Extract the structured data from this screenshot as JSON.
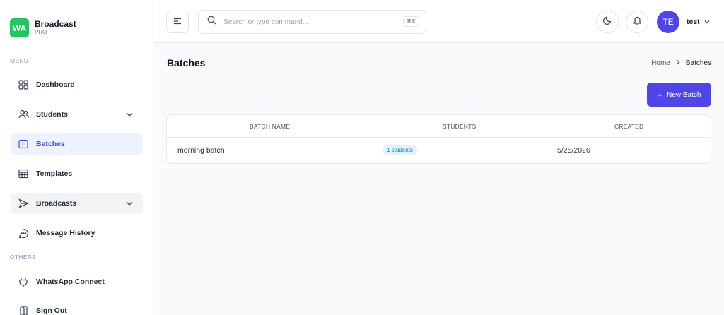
{
  "brand": {
    "logo_text": "WA",
    "name": "Broadcast",
    "sub": "PRO",
    "logo_color": "#22c55e"
  },
  "sidebar": {
    "menu_label": "MENU",
    "others_label": "OTHERS",
    "items": [
      {
        "label": "Dashboard",
        "icon": "grid-icon"
      },
      {
        "label": "Students",
        "icon": "users-icon",
        "expandable": true
      },
      {
        "label": "Batches",
        "icon": "list-box-icon",
        "active": true
      },
      {
        "label": "Templates",
        "icon": "table-icon"
      },
      {
        "label": "Broadcasts",
        "icon": "send-icon",
        "expandable": true
      },
      {
        "label": "Message History",
        "icon": "chat-bubble-icon"
      }
    ],
    "others": [
      {
        "label": "WhatsApp Connect",
        "icon": "plug-icon"
      },
      {
        "label": "Sign Out",
        "icon": "door-icon"
      }
    ]
  },
  "header": {
    "search_placeholder": "Search or type command...",
    "shortcut": "⌘K",
    "avatar_initials": "TE",
    "username": "test"
  },
  "page": {
    "title": "Batches",
    "breadcrumb": [
      "Home",
      "Batches"
    ],
    "new_button": "New Batch"
  },
  "table": {
    "columns": [
      "BATCH NAME",
      "STUDENTS",
      "CREATED"
    ],
    "rows": [
      {
        "name": "morning batch",
        "students": "1 students",
        "created": "5/25/2026"
      }
    ]
  },
  "colors": {
    "accent": "#4f46e5",
    "active_nav_bg": "#eef2ff",
    "badge_bg": "#e0f2fe",
    "badge_text": "#0284c7"
  }
}
